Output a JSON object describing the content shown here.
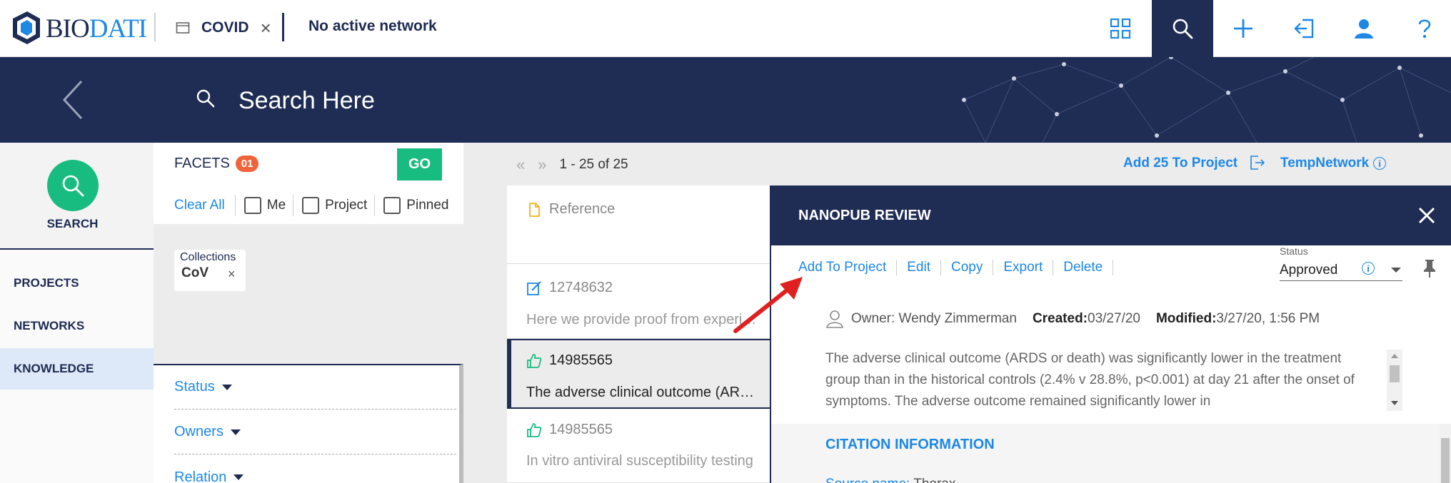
{
  "app": {
    "logo_bio": "BIO",
    "logo_dati": "DATI",
    "tab_label": "COVID",
    "tab_close": "×",
    "network_status": "No active network",
    "icons": [
      "grid-icon",
      "search-icon",
      "plus-icon",
      "sign-in-icon",
      "user-icon",
      "help-icon"
    ]
  },
  "banner": {
    "search_placeholder": "Search Here"
  },
  "sidebar": {
    "search_label": "SEARCH",
    "items": [
      {
        "label": "PROJECTS",
        "active": false
      },
      {
        "label": "NETWORKS",
        "active": false
      },
      {
        "label": "KNOWLEDGE",
        "active": true
      }
    ]
  },
  "facets": {
    "title": "FACETS",
    "count": "01",
    "go_label": "GO",
    "clear_all": "Clear All",
    "checkboxes": [
      {
        "label": "Me",
        "checked": false
      },
      {
        "label": "Project",
        "checked": false
      },
      {
        "label": "Pinned",
        "checked": false
      }
    ],
    "collections": {
      "title": "Collections",
      "value": "CoV",
      "remove": "×"
    },
    "groups": [
      {
        "label": "Status"
      },
      {
        "label": "Owners"
      },
      {
        "label": "Relation"
      }
    ]
  },
  "results": {
    "pager_prev": "«",
    "pager_next": "»",
    "range": "1 - 25 of 25",
    "add_to_project": "Add 25 To Project",
    "temp_network": "TempNetwork",
    "info": "i",
    "cards": [
      {
        "id": "Reference",
        "text": "",
        "icon": "file-icon"
      },
      {
        "id": "12748632",
        "text": "Here we provide proof from experimental data",
        "icon": "edit-icon"
      },
      {
        "id": "14985565",
        "text": "The adverse clinical outcome (ARDS or death)",
        "icon": "thumbs-up-icon",
        "selected": true
      },
      {
        "id": "14985565",
        "text": "In vitro antiviral susceptibility testing",
        "icon": "thumbs-up-icon"
      }
    ]
  },
  "review": {
    "title": "NANOPUB REVIEW",
    "close": "×",
    "actions": [
      "Add To Project",
      "Edit",
      "Copy",
      "Export",
      "Delete"
    ],
    "status_label": "Status",
    "status_value": "Approved",
    "owner": "Owner: Wendy Zimmerman",
    "created_label": "Created:",
    "created_value": "03/27/20",
    "modified_label": "Modified:",
    "modified_value": "3/27/20, 1:56 PM",
    "abstract": "The adverse clinical outcome (ARDS or death) was significantly lower in the treatment group than in the historical controls (2.4% v 28.8%, p<0.001) at day 21 after the onset of symptoms. The adverse outcome remained significantly lower in",
    "citation_title": "CITATION INFORMATION",
    "source_key": "Source name:",
    "source_value": " Thorax"
  },
  "colors": {
    "navy": "#1f2d55",
    "accent_blue": "#1e88e5",
    "green": "#19bc80",
    "badge_orange": "#f0643c",
    "annotation_arrow": "#e02020"
  }
}
